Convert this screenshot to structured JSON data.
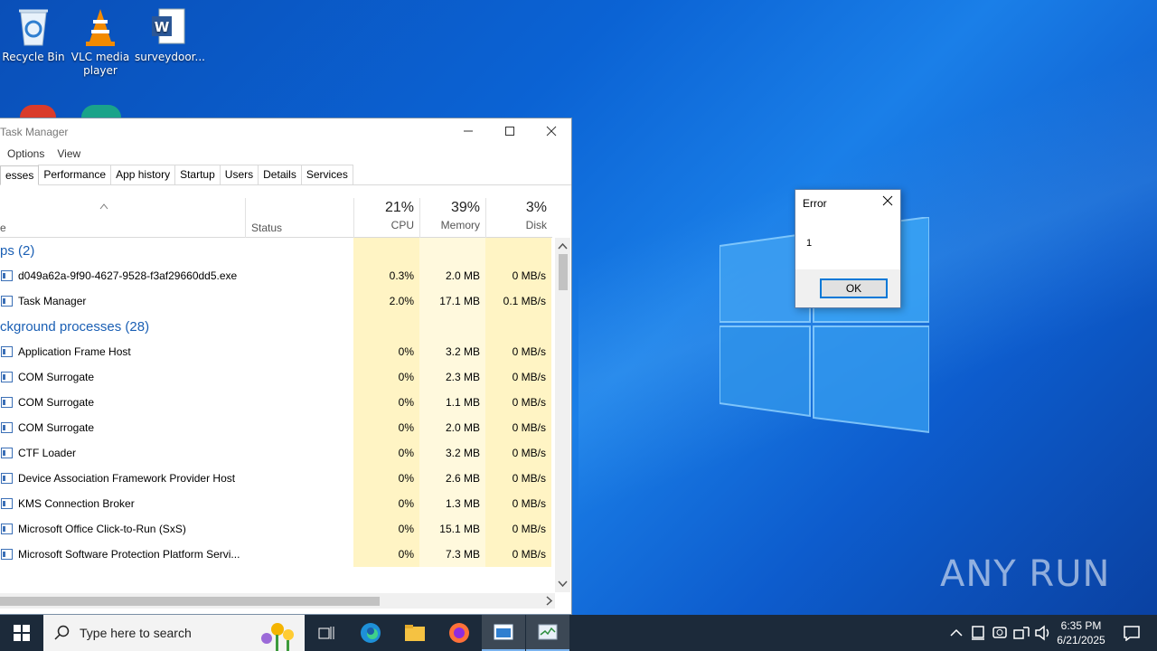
{
  "desktop": {
    "icons": [
      {
        "label": "Recycle Bin"
      },
      {
        "label": "VLC media player"
      },
      {
        "label": "surveydoor..."
      }
    ]
  },
  "task_manager": {
    "title": "Task Manager",
    "menu": [
      "Options",
      "View"
    ],
    "tabs": [
      "esses",
      "Performance",
      "App history",
      "Startup",
      "Users",
      "Details",
      "Services"
    ],
    "headers": {
      "name": "e",
      "status": "Status",
      "cpu_pct": "21%",
      "cpu": "CPU",
      "mem_pct": "39%",
      "mem": "Memory",
      "disk_pct": "3%",
      "disk": "Disk"
    },
    "rows": [
      {
        "type": "group",
        "name": "ps (2)"
      },
      {
        "type": "proc",
        "name": "d049a62a-9f90-4627-9528-f3af29660dd5.exe",
        "cpu": "0.3%",
        "mem": "2.0 MB",
        "disk": "0 MB/s"
      },
      {
        "type": "proc",
        "name": "Task Manager",
        "cpu": "2.0%",
        "mem": "17.1 MB",
        "disk": "0.1 MB/s"
      },
      {
        "type": "group",
        "name": "ckground processes (28)"
      },
      {
        "type": "proc",
        "name": "Application Frame Host",
        "cpu": "0%",
        "mem": "3.2 MB",
        "disk": "0 MB/s"
      },
      {
        "type": "proc",
        "name": "COM Surrogate",
        "cpu": "0%",
        "mem": "2.3 MB",
        "disk": "0 MB/s"
      },
      {
        "type": "proc",
        "name": "COM Surrogate",
        "cpu": "0%",
        "mem": "1.1 MB",
        "disk": "0 MB/s"
      },
      {
        "type": "proc",
        "name": "COM Surrogate",
        "cpu": "0%",
        "mem": "2.0 MB",
        "disk": "0 MB/s"
      },
      {
        "type": "proc",
        "name": "CTF Loader",
        "cpu": "0%",
        "mem": "3.2 MB",
        "disk": "0 MB/s"
      },
      {
        "type": "proc",
        "name": "Device Association Framework Provider Host",
        "cpu": "0%",
        "mem": "2.6 MB",
        "disk": "0 MB/s"
      },
      {
        "type": "proc",
        "name": "KMS Connection Broker",
        "cpu": "0%",
        "mem": "1.3 MB",
        "disk": "0 MB/s"
      },
      {
        "type": "proc",
        "name": "Microsoft Office Click-to-Run (SxS)",
        "cpu": "0%",
        "mem": "15.1 MB",
        "disk": "0 MB/s"
      },
      {
        "type": "proc",
        "name": "Microsoft Software Protection Platform Servi...",
        "cpu": "0%",
        "mem": "7.3 MB",
        "disk": "0 MB/s"
      }
    ]
  },
  "error_dialog": {
    "title": "Error",
    "message": "1",
    "ok": "OK"
  },
  "watermark": "ANY RUN",
  "taskbar": {
    "search_placeholder": "Type here to search",
    "time": "6:35 PM",
    "date": "6/21/2025"
  }
}
